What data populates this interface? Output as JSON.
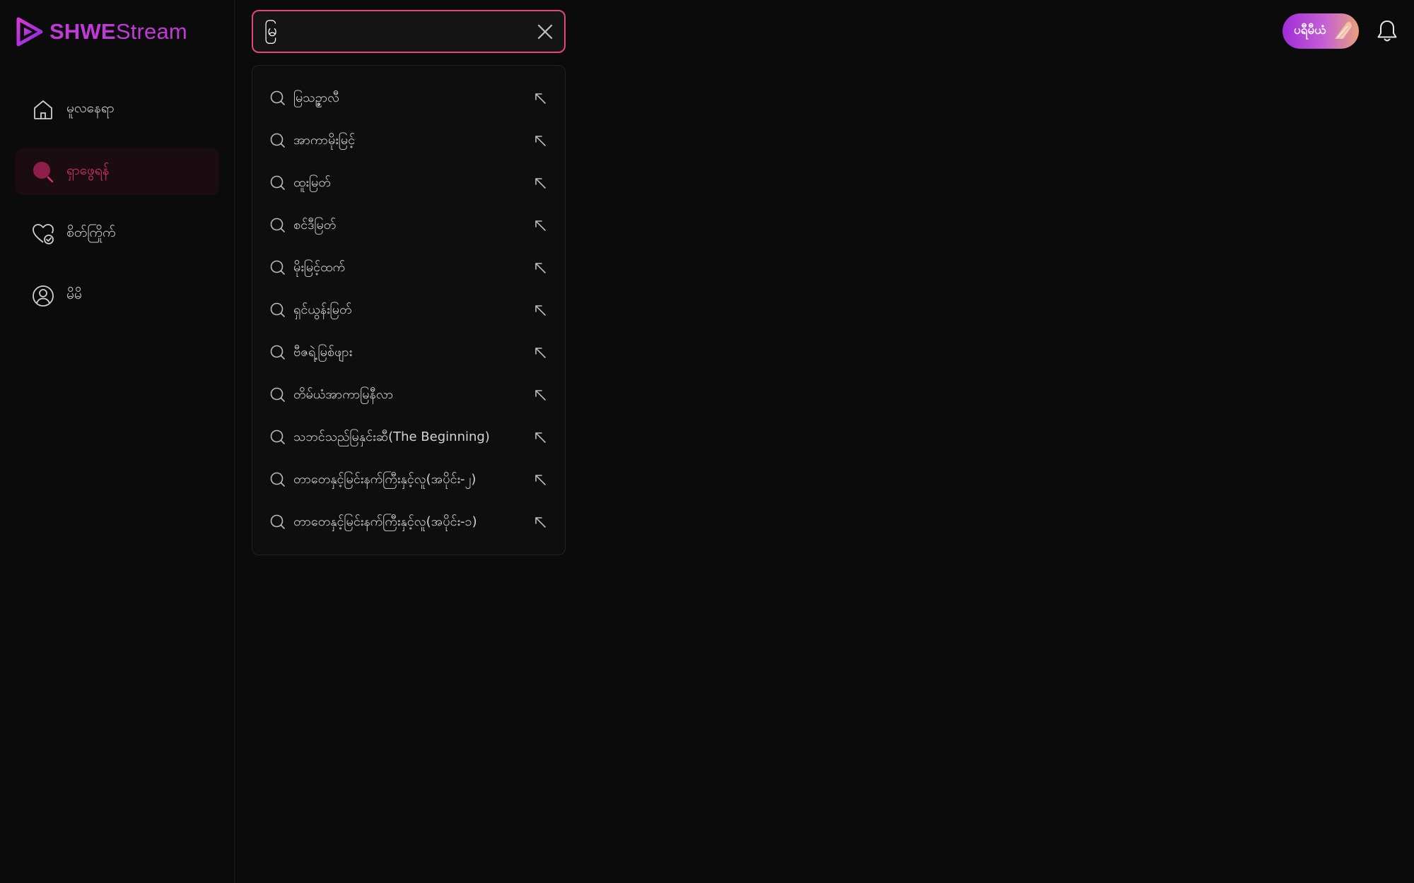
{
  "app": {
    "logo_bold": "SHWE",
    "logo_light": "Stream"
  },
  "sidebar": {
    "items": [
      {
        "label": "မူလနေရာ",
        "icon": "home-icon"
      },
      {
        "label": "ရှာဖွေရန်",
        "icon": "search-icon",
        "active": true
      },
      {
        "label": "စိတ်ကြိုက်",
        "icon": "heart-check-icon"
      },
      {
        "label": "မိမိ",
        "icon": "user-circle-icon"
      }
    ]
  },
  "search": {
    "value": "မြ",
    "placeholder": ""
  },
  "suggestions": [
    "မြသဉ္ဇာလီ",
    "အာကာမိုးမြင့်",
    "ထူးမြတ်",
    "စင်ဒီမြတ်",
    "မိုးမြင့်ထက်",
    "ရှင်ယွန်းမြတ်",
    "ဗီဇရဲ့မြစ်ဖျား",
    "တိမ်ယံအာကာမြနီလာ",
    "သဘင်သည်မြနှင်းဆီ(The Beginning)",
    "တာတေနှင့်မြင်းနက်ကြီးနှင့်လူ(အပိုင်း-၂)",
    "တာတေနှင့်မြင်းနက်ကြီးနှင့်လူ(အပိုင်း-၁)"
  ],
  "header": {
    "premium_label": "ပရီမီယံ"
  },
  "colors": {
    "accent": "#e4457d",
    "brand": "#c03ad8",
    "background": "#0b0b0b"
  }
}
